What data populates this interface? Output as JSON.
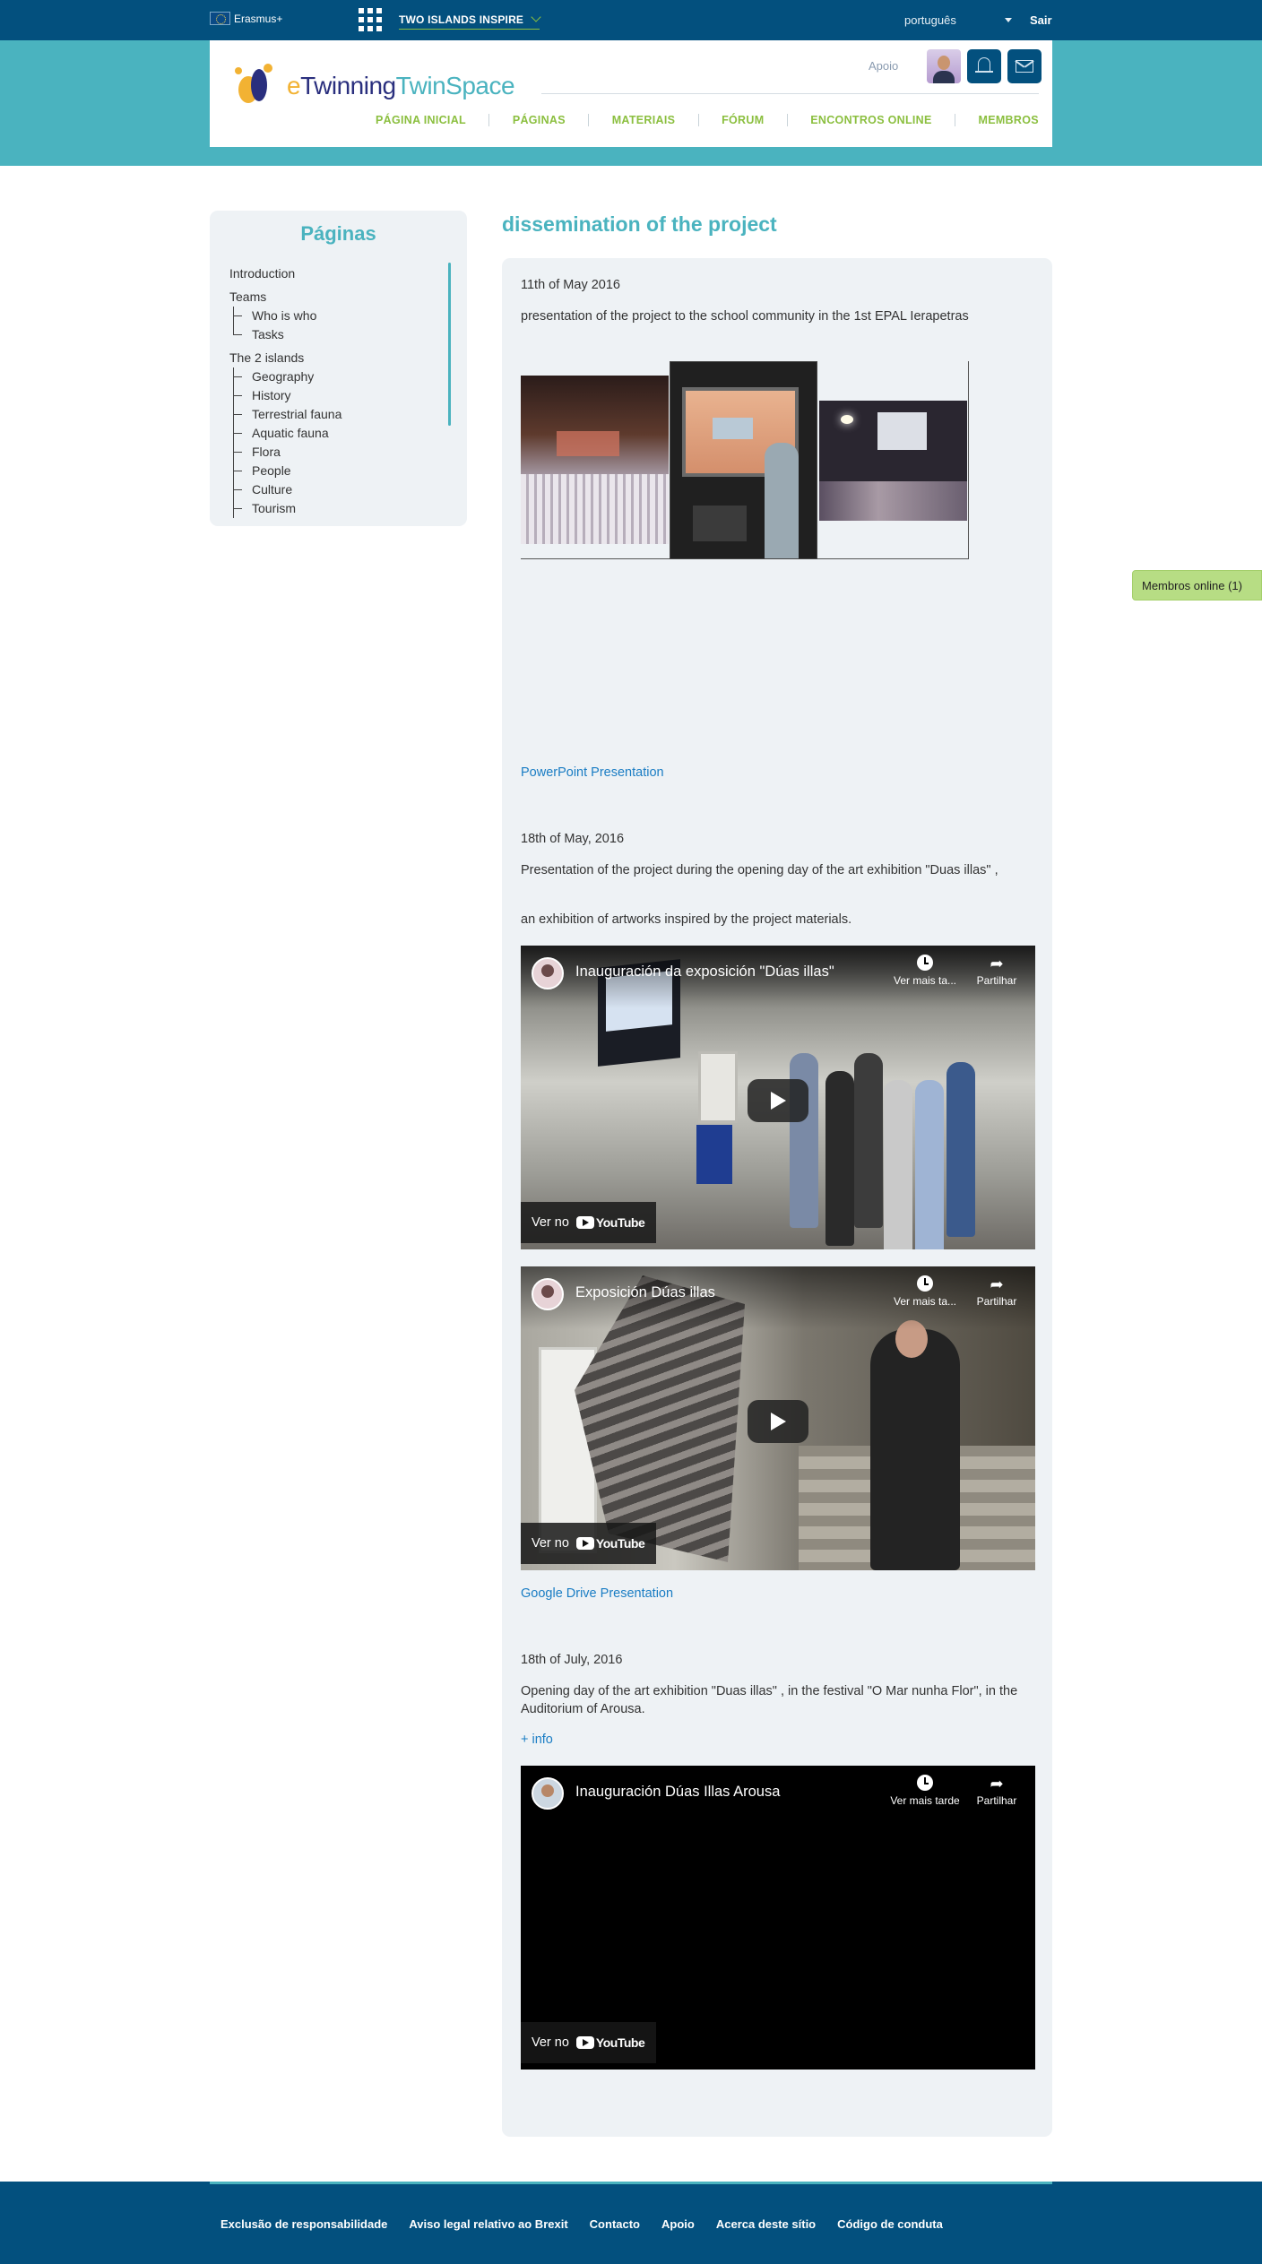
{
  "topbar": {
    "erasmus_label": "Erasmus+",
    "project_name": "TWO ISLANDS INSPIRE",
    "language": "português",
    "logout": "Sair"
  },
  "header": {
    "logo": {
      "e": "e",
      "twinning": "Twinning",
      "twinspace": "TwinSpace"
    },
    "support": "Apoio",
    "nav": [
      "PÁGINA INICIAL",
      "PÁGINAS",
      "MATERIAIS",
      "FÓRUM",
      "ENCONTROS ONLINE",
      "MEMBROS"
    ]
  },
  "sidebar": {
    "title": "Páginas",
    "items": [
      {
        "label": "Introduction",
        "level": 1
      },
      {
        "label": "Teams",
        "level": 1
      },
      {
        "label": "Who is who",
        "level": 2
      },
      {
        "label": "Tasks",
        "level": 2
      },
      {
        "label": "The 2 islands",
        "level": 1
      },
      {
        "label": "Geography",
        "level": 2
      },
      {
        "label": "History",
        "level": 2
      },
      {
        "label": "Terrestrial fauna",
        "level": 2
      },
      {
        "label": "Aquatic fauna",
        "level": 2
      },
      {
        "label": "Flora",
        "level": 2
      },
      {
        "label": "People",
        "level": 2
      },
      {
        "label": "Culture",
        "level": 2
      },
      {
        "label": "Tourism",
        "level": 2
      }
    ]
  },
  "page": {
    "title": "dissemination of the project",
    "section1": {
      "date": "11th of May 2016",
      "text": "presentation of the project to the school community in the 1st EPAL Ierapetras",
      "link": "PowerPoint Presentation"
    },
    "section2": {
      "date": "18th of May, 2016",
      "text1": "Presentation of the project during the opening day of the art exhibition \"Duas illas\" ,",
      "text2": "an exhibition of artworks inspired by the project materials.",
      "link": "Google Drive Presentation"
    },
    "section3": {
      "date": "18th of July, 2016",
      "text": "Opening day of the art exhibition \"Duas illas\" , in the festival \"O Mar nunha Flor\", in the Auditorium of Arousa.",
      "more": "+ info"
    },
    "videos": [
      {
        "title": "Inauguración da exposición \"Dúas illas\"",
        "watch_later": "Ver mais ta...",
        "share": "Partilhar",
        "watch_on": "Ver no",
        "yt": "YouTube"
      },
      {
        "title": "Exposición Dúas illas",
        "watch_later": "Ver mais ta...",
        "share": "Partilhar",
        "watch_on": "Ver no",
        "yt": "YouTube"
      },
      {
        "title": "Inauguración Dúas Illas Arousa",
        "watch_later": "Ver mais tarde",
        "share": "Partilhar",
        "watch_on": "Ver no",
        "yt": "YouTube"
      }
    ]
  },
  "members_online": "Membros online (1)",
  "footer": {
    "links": [
      "Exclusão de responsabilidade",
      "Aviso legal relativo ao Brexit",
      "Contacto",
      "Apoio",
      "Acerca deste sítio",
      "Código de conduta"
    ]
  },
  "colors": {
    "topbar": "#03507e",
    "teal": "#4ab3bf",
    "nav_green": "#8bbf3f",
    "link_blue": "#1a7dc4",
    "panel_bg": "#eef2f5"
  }
}
